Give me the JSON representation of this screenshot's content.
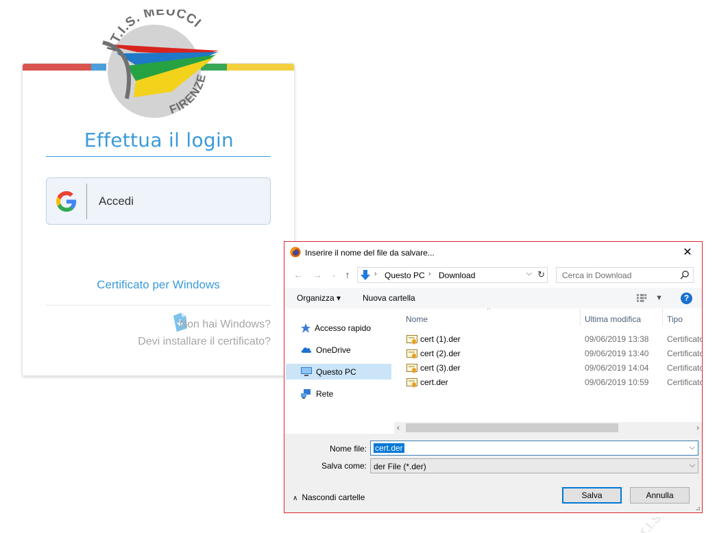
{
  "login": {
    "logo": {
      "top_text": "I.T.I.S. MEUCCI",
      "bottom_text": "FIRENZE"
    },
    "stripe_colors": [
      "#d9534f",
      "#4ba0dc",
      "#3aa757",
      "#f4d03f"
    ],
    "title": "Effettua il login",
    "google_button": {
      "label": "Accedi",
      "icon": "google-g-icon"
    },
    "certificate_link": {
      "label": "Certificato per Windows",
      "icon": "certificate-download-icon"
    },
    "help": {
      "line1": "Non hai Windows?",
      "line2": "Devi installare il certificato?"
    },
    "accent_color": "#3b9ad9"
  },
  "dialog": {
    "title": "Inserire il nome del file da salvare...",
    "app_icon": "firefox-icon",
    "border_color": "#d9242e",
    "address": {
      "crumbs": [
        "Questo PC",
        "Download"
      ]
    },
    "search": {
      "placeholder": "Cerca in Download"
    },
    "toolbar": {
      "organize_label": "Organizza ▾",
      "new_folder_label": "Nuova cartella",
      "help_label": "?"
    },
    "nav_items": [
      {
        "label": "Accesso rapido",
        "icon": "star-icon",
        "selected": false
      },
      {
        "label": "OneDrive",
        "icon": "cloud-icon",
        "selected": false
      },
      {
        "label": "Questo PC",
        "icon": "computer-icon",
        "selected": true
      },
      {
        "label": "Rete",
        "icon": "network-icon",
        "selected": false
      }
    ],
    "columns": [
      "Nome",
      "Ultima modifica",
      "Tipo"
    ],
    "files": [
      {
        "name": "cert (1).der",
        "modified": "09/06/2019 13:38",
        "type": "Certificato"
      },
      {
        "name": "cert (2).der",
        "modified": "09/06/2019 13:40",
        "type": "Certificato"
      },
      {
        "name": "cert (3).der",
        "modified": "09/06/2019 14:04",
        "type": "Certificato"
      },
      {
        "name": "cert.der",
        "modified": "09/06/2019 10:59",
        "type": "Certificato"
      }
    ],
    "filename_label": "Nome file:",
    "filename_value": "cert.der",
    "savetype_label": "Salva come:",
    "savetype_value": "der File (*.der)",
    "hide_folders_label": "Nascondi cartelle",
    "save_label": "Salva",
    "cancel_label": "Annulla"
  },
  "watermark_text": "I.T.I.S. MEUCCI"
}
